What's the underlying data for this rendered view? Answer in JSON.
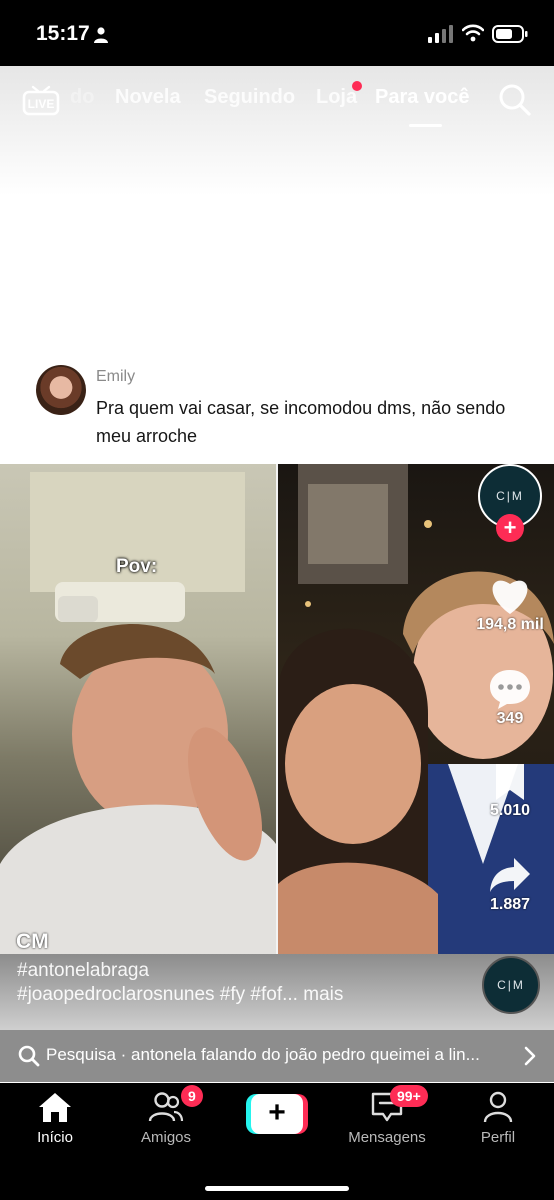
{
  "status_bar": {
    "time": "15:17"
  },
  "top_nav": {
    "live_label": "LIVE",
    "tabs": [
      {
        "label": "do"
      },
      {
        "label": "Novela"
      },
      {
        "label": "Seguindo"
      },
      {
        "label": "Loja"
      },
      {
        "label": "Para você"
      }
    ]
  },
  "comment": {
    "username": "Emily",
    "text": "Pra quem vai casar, se incomodou dms, não sendo meu arroche"
  },
  "video": {
    "overlay_text": "Pov:",
    "watermark": "CM",
    "creator_initials": "C|M",
    "follow_symbol": "+",
    "like_count": "194,8 mil",
    "comment_count": "349",
    "bookmark_count": "5.010",
    "share_count": "1.887",
    "caption_line1": "#antonelabraga",
    "caption_line2": "#joaopedroclarosnunes #fy #fof... mais",
    "music_initials": "C|M"
  },
  "search_suggestion": {
    "text": "Pesquisa · antonela falando do joão pedro queimei a lin..."
  },
  "bottom_nav": {
    "home": "Início",
    "friends": "Amigos",
    "friends_badge": "9",
    "create_symbol": "+",
    "messages": "Mensagens",
    "messages_badge": "99+",
    "profile": "Perfil"
  },
  "colors": {
    "accent_red": "#fe2c55",
    "accent_cyan": "#25f4ee",
    "nav_bg": "#000000"
  }
}
